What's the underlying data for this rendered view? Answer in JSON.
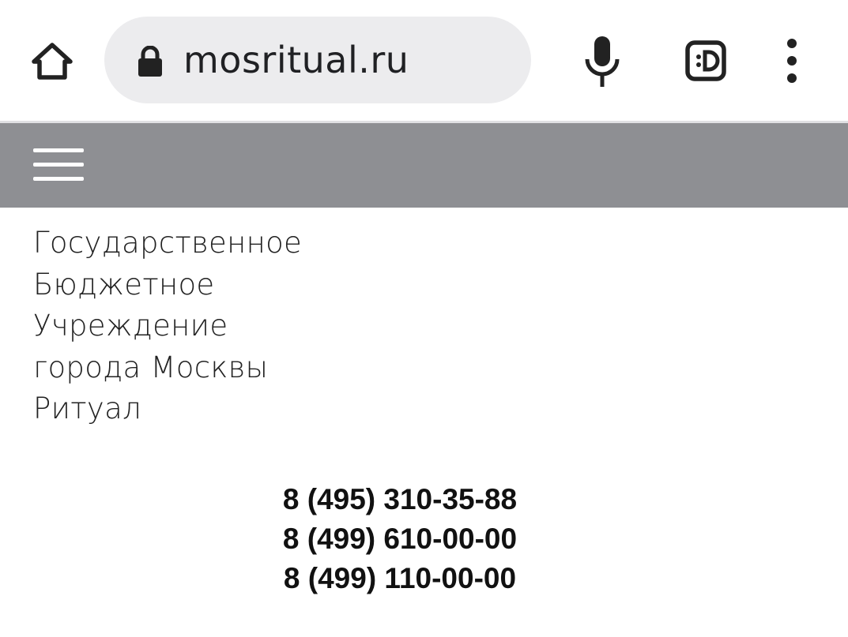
{
  "browser": {
    "url": "mosritual.ru",
    "icons": [
      "home-icon",
      "lock-icon",
      "microphone-icon",
      "tab-switcher-icon",
      "more-vert-icon"
    ]
  },
  "site": {
    "header_bg": "#8e8f93",
    "org_lines": [
      "Государственное",
      "Бюджетное",
      "Учреждение",
      "города Москвы",
      "Ритуал"
    ],
    "phones": [
      "8 (495) 310-35-88",
      "8 (499) 610-00-00",
      "8 (499) 110-00-00"
    ]
  }
}
